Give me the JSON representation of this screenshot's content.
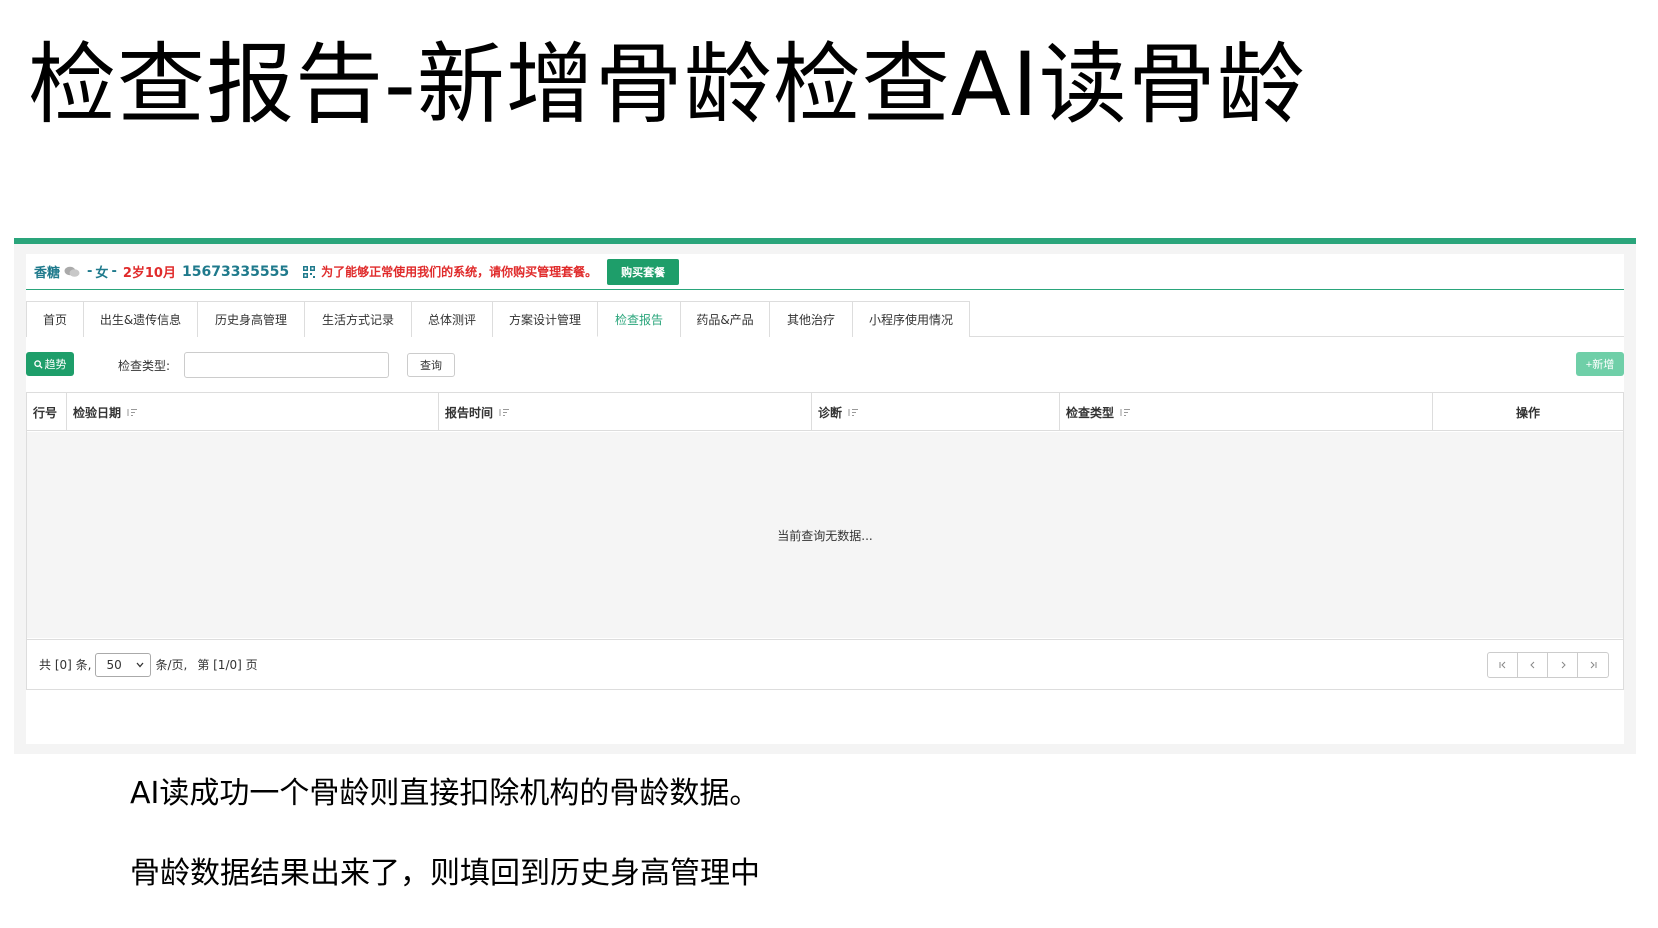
{
  "slide": {
    "title": "检查报告-新增骨龄检查AI读骨龄",
    "notes": [
      "AI读成功一个骨龄则直接扣除机构的骨龄数据。",
      "骨龄数据结果出来了，则填回到历史身高管理中"
    ]
  },
  "patient": {
    "name": "香糖",
    "sep1": "-",
    "gender": "女",
    "sep2": "-",
    "age": "2岁10月",
    "phone": "15673335555",
    "warning": "为了能够正常使用我们的系统，请你购买管理套餐。",
    "buy_label": "购买套餐"
  },
  "tabs": [
    {
      "label": "首页"
    },
    {
      "label": "出生&遗传信息"
    },
    {
      "label": "历史身高管理"
    },
    {
      "label": "生活方式记录"
    },
    {
      "label": "总体测评"
    },
    {
      "label": "方案设计管理"
    },
    {
      "label": "检查报告",
      "active": true
    },
    {
      "label": "药品&产品"
    },
    {
      "label": "其他治疗"
    },
    {
      "label": "小程序使用情况"
    }
  ],
  "toolbar": {
    "trend_label": "趋势",
    "type_label": "检查类型:",
    "type_value": "",
    "query_label": "查询",
    "add_label": "+新增"
  },
  "table": {
    "columns": [
      "行号",
      "检验日期",
      "报告时间",
      "诊断",
      "检查类型",
      "操作"
    ],
    "empty_text": "当前查询无数据...",
    "footer": {
      "total": "共 [0] 条,",
      "page_size": "50",
      "per_page": "条/页,",
      "page_info": "第 [1/0] 页"
    }
  },
  "colors": {
    "accent": "#2aa57b",
    "button_green": "#1e9e6a",
    "warn_red": "#e02b2b",
    "name_teal": "#1f7a8c"
  }
}
